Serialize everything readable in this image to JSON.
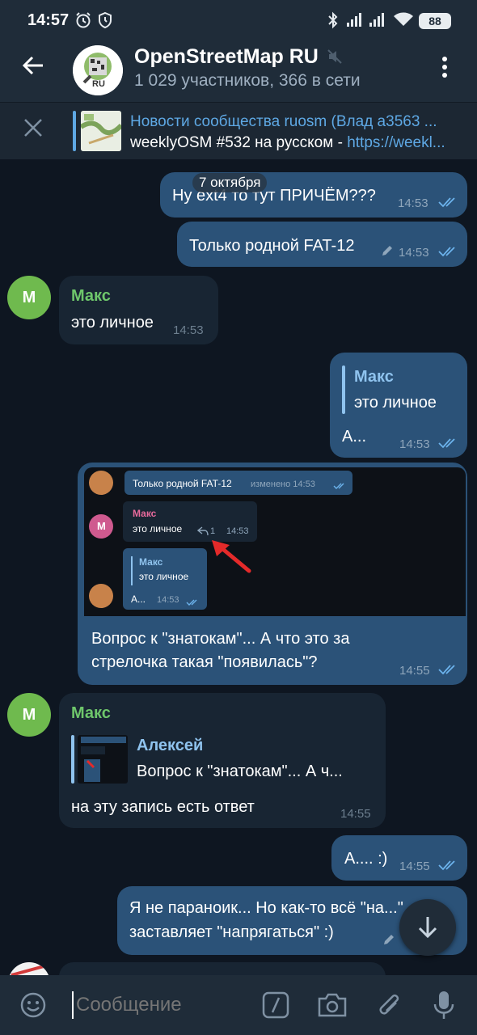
{
  "status_bar": {
    "time": "14:57",
    "battery": "88",
    "icons": [
      "alarm-icon",
      "clock-icon",
      "bluetooth-icon",
      "signal-icon",
      "signal-icon",
      "wifi-icon",
      "battery-icon"
    ]
  },
  "header": {
    "title": "OpenStreetMap RU",
    "subtitle": "1 029 участников, 366 в сети",
    "avatar_text": "RU",
    "icons": [
      "back-arrow-icon",
      "muted-icon",
      "more-vertical-icon"
    ]
  },
  "pinned": {
    "title": "Новости сообщества ruosm (Влад a3563 ...",
    "text": "weeklyOSM #532 на русском - ",
    "link": "https://weekl..."
  },
  "date_chip": "7 октября",
  "messages": [
    {
      "dir": "out",
      "text": "Ну ext4 то тут ПРИЧЁМ???",
      "time": "14:53",
      "read": true
    },
    {
      "dir": "out",
      "text": "Только родной FAT-12",
      "time": "14:53",
      "edited": true,
      "read": true
    },
    {
      "dir": "in",
      "sender": "Макс",
      "avatar_letter": "М",
      "text": "это личное",
      "time": "14:53"
    },
    {
      "dir": "out",
      "reply_name": "Макс",
      "reply_text": "это личное",
      "text": "А...",
      "time": "14:53",
      "read": true
    },
    {
      "dir": "out",
      "image": true,
      "text_line1": "Вопрос к \"знатокам\"... А что это за",
      "text_line2": "стрелочка такая \"появилась\"?",
      "time": "14:55",
      "read": true
    },
    {
      "dir": "in",
      "sender": "Макс",
      "avatar_letter": "М",
      "reply_name": "Алексей",
      "reply_text": "Вопрос к \"знатокам\"... А ч...",
      "text": "на эту запись есть ответ",
      "time": "14:55"
    },
    {
      "dir": "out",
      "text": "А.... :)",
      "time": "14:55",
      "read": true
    },
    {
      "dir": "out",
      "text_line1": "Я не параноик... Но как-то всё \"на...\"",
      "text_line2": "заставляет \"напрягаться\" :)",
      "edited": true
    }
  ],
  "screenshot": {
    "msg1_text": "Только родной FAT-12",
    "msg1_meta": "изменено 14:53",
    "msg2_sender": "Макс",
    "msg2_text": "это личное",
    "msg2_replies": "1",
    "msg2_time": "14:53",
    "msg2_avatar": "М",
    "msg3_reply_name": "Макс",
    "msg3_reply_text": "это личное",
    "msg3_text": "А...",
    "msg3_time": "14:53"
  },
  "input": {
    "placeholder": "Сообщение",
    "icons": [
      "emoji-icon",
      "bot-command-icon",
      "camera-icon",
      "attach-icon",
      "mic-icon"
    ]
  }
}
